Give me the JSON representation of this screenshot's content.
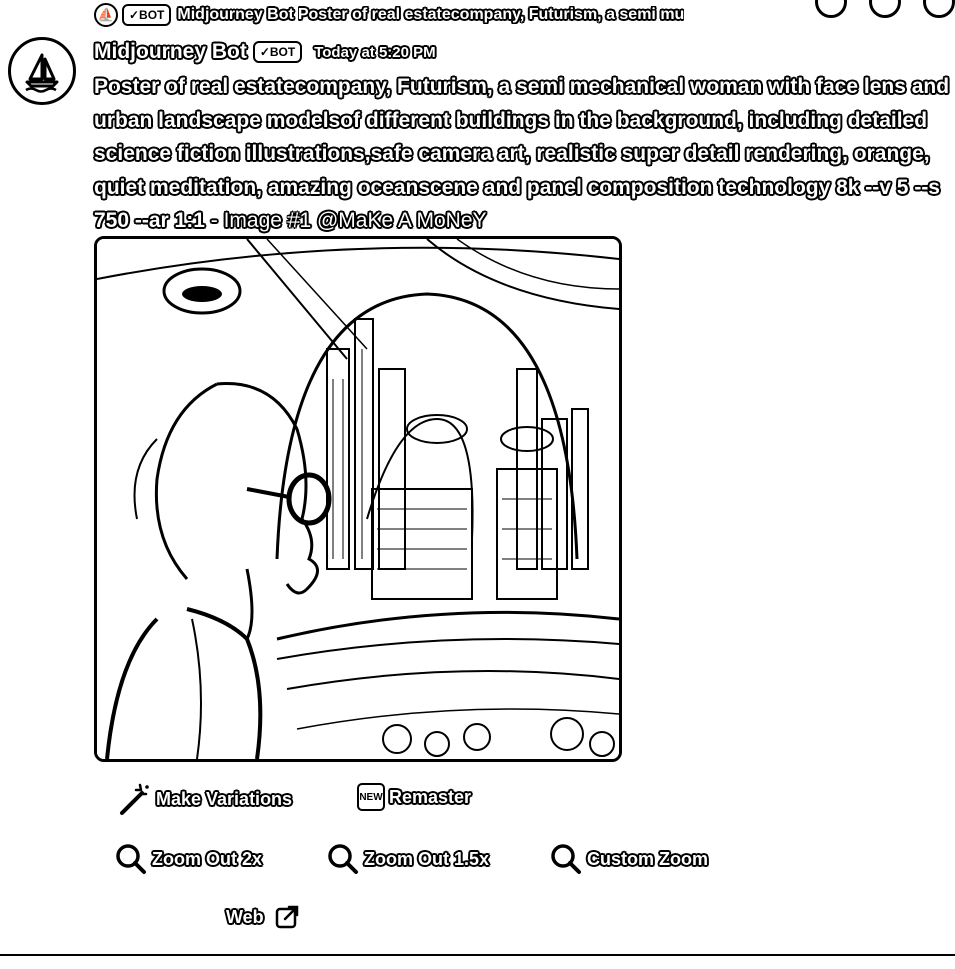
{
  "reply": {
    "bot_tag": "✓BOT",
    "author": "Midjourney Bot",
    "preview": "Poster of real estatecompany, Futurism, a semi mu"
  },
  "message": {
    "author": "Midjourney Bot",
    "bot_tag": "✓BOT",
    "timestamp": "Today at 5:20 PM",
    "prompt": "Poster of real estatecompany, Futurism, a semi mechanical woman with face lens and urban landscape modelsof different buildings in the background, including detailed science fiction illustrations,safe camera art, realistic super detail rendering, orange, quiet meditation, amazing oceanscene and panel composition technology 8k --v 5 --s 750 --ar 1:1",
    "suffix": " - Image #1 @MaKe A MoNeY"
  },
  "attachment": {
    "alt": "Futuristic city poster with woman wearing lens glasses"
  },
  "buttons": {
    "make_variations": "Make Variations",
    "remaster": "Remaster",
    "remaster_badge": "NEW",
    "zoom_out_2x": "Zoom Out 2x",
    "zoom_out_1_5x": "Zoom Out 1.5x",
    "custom_zoom": "Custom Zoom",
    "web": "Web"
  },
  "icons": {
    "magic": "magic-wand-icon",
    "zoom": "magnifier-icon",
    "external": "external-link-icon",
    "avatar": "sailboat-icon"
  },
  "colors": {
    "background": "#ffffff",
    "ink": "#000000"
  }
}
